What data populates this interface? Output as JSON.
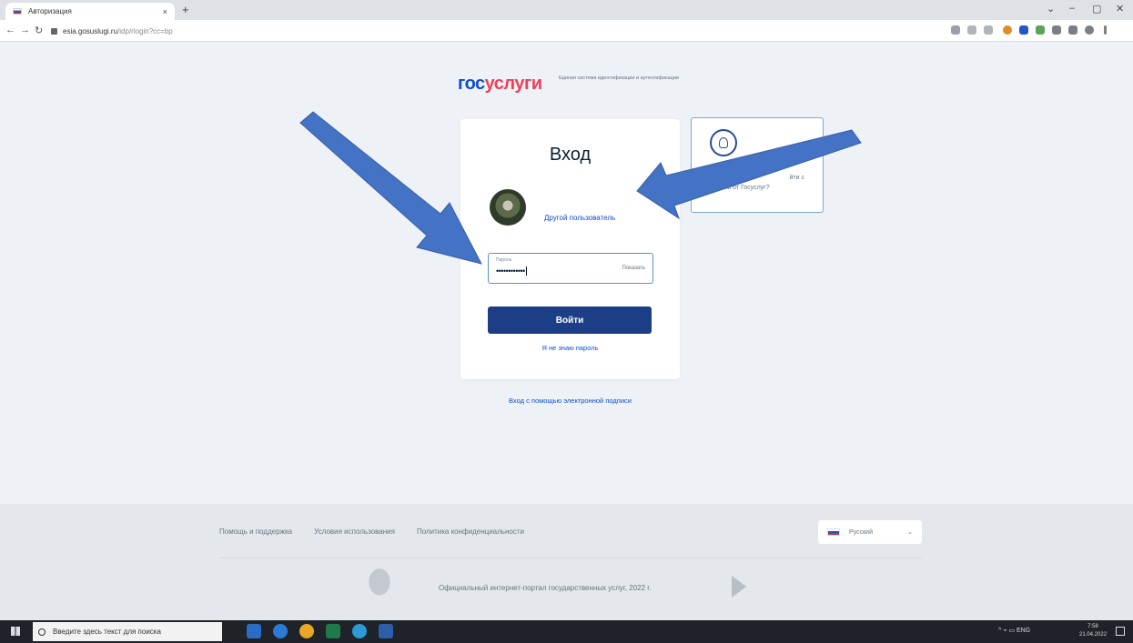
{
  "browser": {
    "tab_title": "Авторизация",
    "tab_close": "×",
    "new_tab": "+",
    "url_host": "esia.gosuslugi.ru",
    "url_path": "/idp/rlogin?cc=bp",
    "window_controls": [
      "⌄",
      "–",
      "▢",
      "✕"
    ]
  },
  "header": {
    "logo_part1": "гос",
    "logo_part2": "услуги",
    "logo_subtitle": "Единая система идентификации и аутентификации"
  },
  "login": {
    "title": "Вход",
    "other_user": "Другой пользователь",
    "password_label": "Пароль",
    "password_value": "••••••••••••",
    "show_label": "Показать",
    "submit_label": "Войти",
    "forgot_label": "Я не знаю пароль",
    "esignature_label": "Вход с помощью электронной подписи"
  },
  "hint": {
    "line1": "йти с",
    "line2": "паролем от Госуслуг?"
  },
  "footer": {
    "links": [
      "Помощь и поддержка",
      "Условия использования",
      "Политика конфиденциальности"
    ],
    "language": "Русский",
    "copyright": "Официальный интернет-портал государственных услуг, 2022 г."
  },
  "taskbar": {
    "search_placeholder": "Введите здесь текст для поиска",
    "tray_lang": "ENG",
    "time": "7:58",
    "date": "21.04.2022"
  },
  "colors": {
    "accent": "#0d4cd3",
    "logo_red": "#ee3f58",
    "button": "#1b3e86",
    "arrow": "#4472c4"
  }
}
